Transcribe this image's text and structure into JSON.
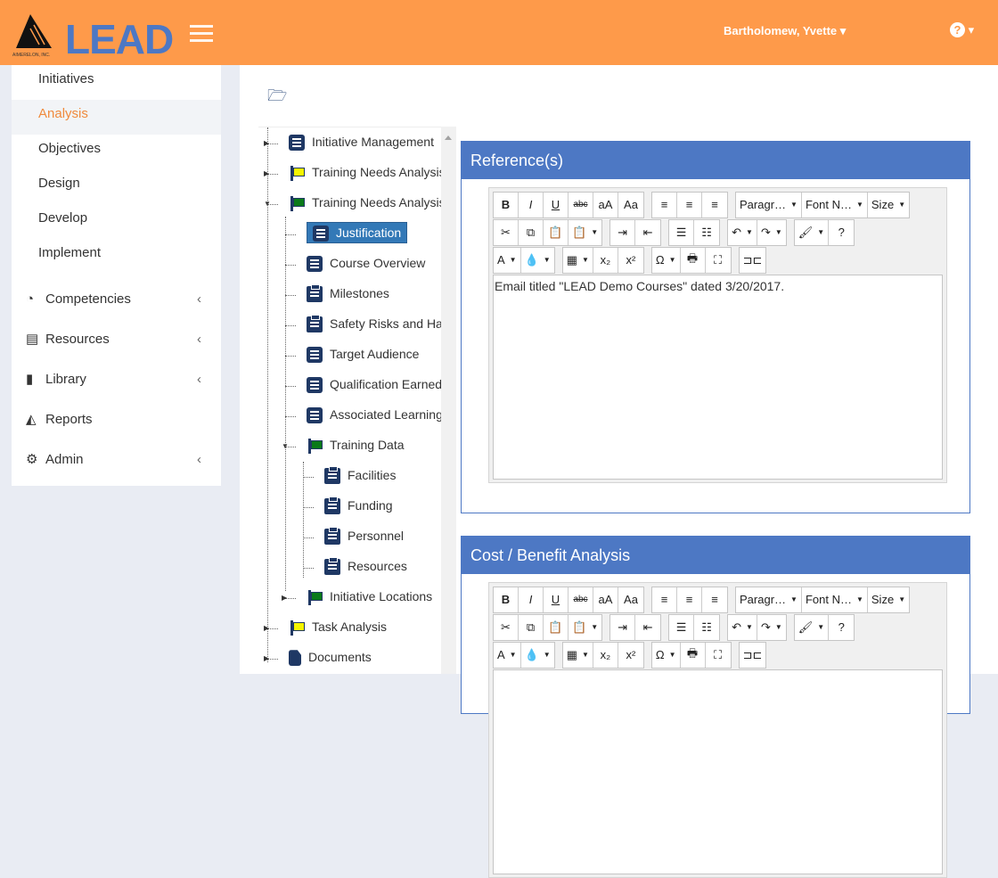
{
  "header": {
    "brand": "LEAD",
    "company": "AIMERELON, INC.",
    "user": "Bartholomew, Yvette",
    "help_icon": "question-circle-icon",
    "colors": {
      "header": "#fe9a4a",
      "brand": "#4d78c4",
      "panel": "#4d78c4"
    }
  },
  "sidebar": {
    "items": [
      {
        "label": "Initiatives"
      },
      {
        "label": "Analysis",
        "active": true
      },
      {
        "label": "Objectives"
      },
      {
        "label": "Design"
      },
      {
        "label": "Develop"
      },
      {
        "label": "Implement"
      }
    ],
    "groups": [
      {
        "label": "Competencies",
        "icon": "dashboard-icon"
      },
      {
        "label": "Resources",
        "icon": "newspaper-icon"
      },
      {
        "label": "Library",
        "icon": "book-icon"
      },
      {
        "label": "Reports",
        "icon": "area-chart-icon"
      },
      {
        "label": "Admin",
        "icon": "gears-icon"
      }
    ]
  },
  "tree": [
    {
      "label": "Initiative Management",
      "icon": "list",
      "level": 0,
      "exp": "▶"
    },
    {
      "label": "Training Needs Analysis",
      "icon": "flag",
      "flag": "#f5f500",
      "level": 0,
      "exp": "▶"
    },
    {
      "label": "Training Needs Analysis",
      "icon": "flag",
      "flag": "#0a7a1a",
      "level": 0,
      "exp": "▼"
    },
    {
      "label": "Justification",
      "icon": "list",
      "level": 1,
      "selected": true
    },
    {
      "label": "Course Overview",
      "icon": "list",
      "level": 1
    },
    {
      "label": "Milestones",
      "icon": "clip",
      "level": 1
    },
    {
      "label": "Safety Risks and Haz",
      "icon": "clip",
      "level": 1
    },
    {
      "label": "Target Audience",
      "icon": "list",
      "level": 1
    },
    {
      "label": "Qualification Earned",
      "icon": "list",
      "level": 1
    },
    {
      "label": "Associated Learning E",
      "icon": "list",
      "level": 1
    },
    {
      "label": "Training Data",
      "icon": "flag",
      "flag": "#0a7a1a",
      "level": 1,
      "exp": "▼"
    },
    {
      "label": "Facilities",
      "icon": "clip",
      "level": 2
    },
    {
      "label": "Funding",
      "icon": "clip",
      "level": 2
    },
    {
      "label": "Personnel",
      "icon": "clip",
      "level": 2
    },
    {
      "label": "Resources",
      "icon": "clip",
      "level": 2
    },
    {
      "label": "Initiative Locations",
      "icon": "flag",
      "flag": "#0a7a1a",
      "level": 1,
      "exp": "▶"
    },
    {
      "label": "Task Analysis",
      "icon": "flag",
      "flag": "#f5f500",
      "level": 0,
      "exp": "▶"
    },
    {
      "label": "Documents",
      "icon": "doc",
      "level": 0,
      "exp": "▶"
    }
  ],
  "toolbar": [
    [
      [
        [
          "bold",
          "B"
        ],
        [
          "italic",
          "I"
        ],
        [
          "underline",
          "U"
        ],
        [
          "strikethrough",
          "abc"
        ],
        [
          "lowercase",
          "aA"
        ],
        [
          "capitalize",
          "Aa"
        ]
      ],
      [
        [
          "align-left",
          "≡"
        ],
        [
          "align-center",
          "≡"
        ],
        [
          "align-right",
          "≡"
        ]
      ],
      [
        [
          "paragraph",
          "Paragr…",
          1
        ],
        [
          "font-name",
          "Font N…",
          1
        ],
        [
          "size",
          "Size",
          1
        ]
      ]
    ],
    [
      [
        [
          "cut",
          "✂"
        ],
        [
          "copy",
          "⧉"
        ],
        [
          "paste",
          "📋"
        ],
        [
          "paste-special",
          "📋",
          1
        ]
      ],
      [
        [
          "indent",
          "⇥"
        ],
        [
          "outdent",
          "⇤"
        ]
      ],
      [
        [
          "bullet-list",
          "☰"
        ],
        [
          "numbered-list",
          "☷"
        ]
      ],
      [
        [
          "undo",
          "↶",
          1
        ],
        [
          "redo",
          "↷",
          1
        ]
      ],
      [
        [
          "format-painter",
          "🖌",
          1
        ],
        [
          "help",
          "?"
        ]
      ]
    ],
    [
      [
        [
          "font-color",
          "A",
          1
        ],
        [
          "highlight",
          "💧",
          1
        ]
      ],
      [
        [
          "table",
          "▦",
          1
        ],
        [
          "subscript",
          "x₂"
        ],
        [
          "superscript",
          "x²"
        ]
      ],
      [
        [
          "special-char",
          "Ω",
          1
        ],
        [
          "print",
          "🖶"
        ],
        [
          "fullscreen",
          "⛶"
        ]
      ],
      [
        [
          "page-break",
          "⊐⊏"
        ]
      ]
    ]
  ],
  "panels": [
    {
      "title": "Reference(s)",
      "content": "Email titled \"LEAD Demo Courses\" dated 3/20/2017."
    },
    {
      "title": "Cost / Benefit Analysis",
      "content": ""
    }
  ]
}
